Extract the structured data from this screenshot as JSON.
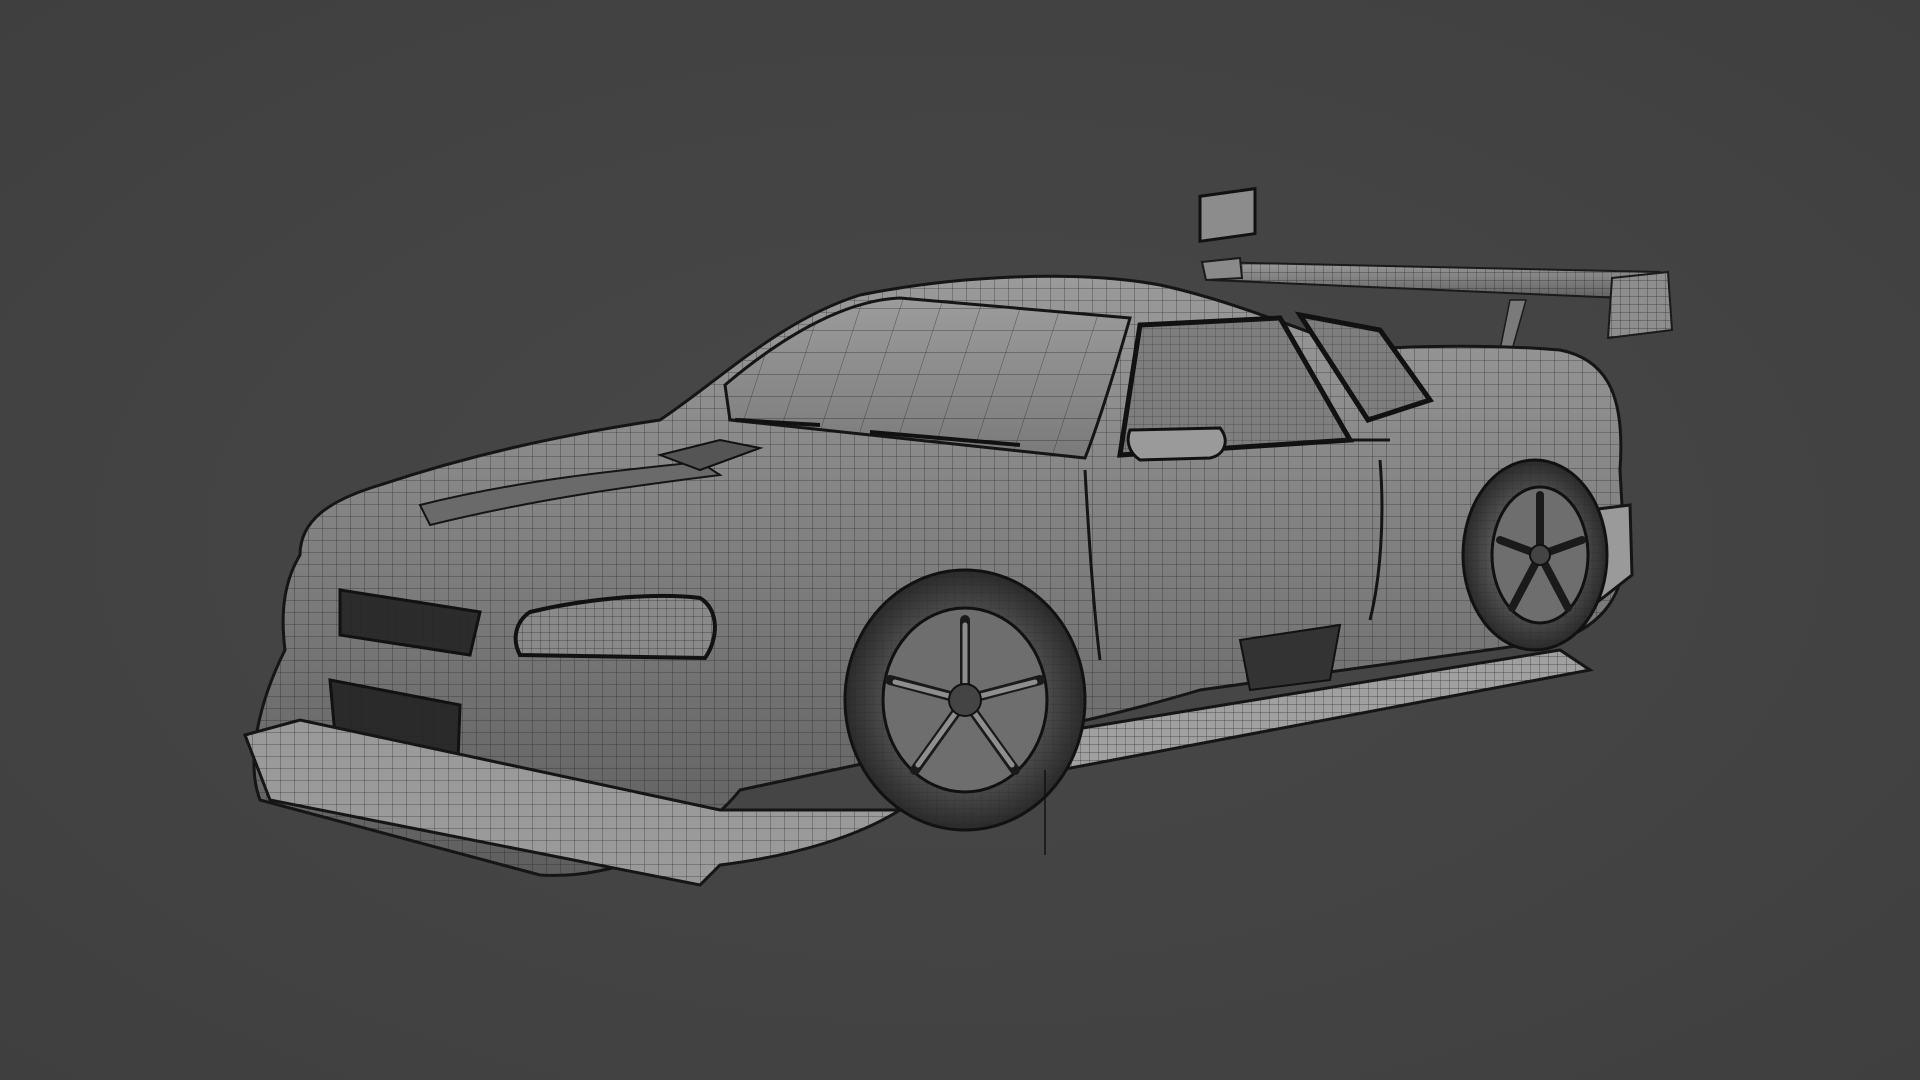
{
  "viewport": {
    "background_color": "#444444",
    "subject": "car-wireframe-model",
    "shading": "solid-with-wireframe",
    "mesh_color": "#8a8a8a",
    "wire_color": "#1e1e1e"
  }
}
